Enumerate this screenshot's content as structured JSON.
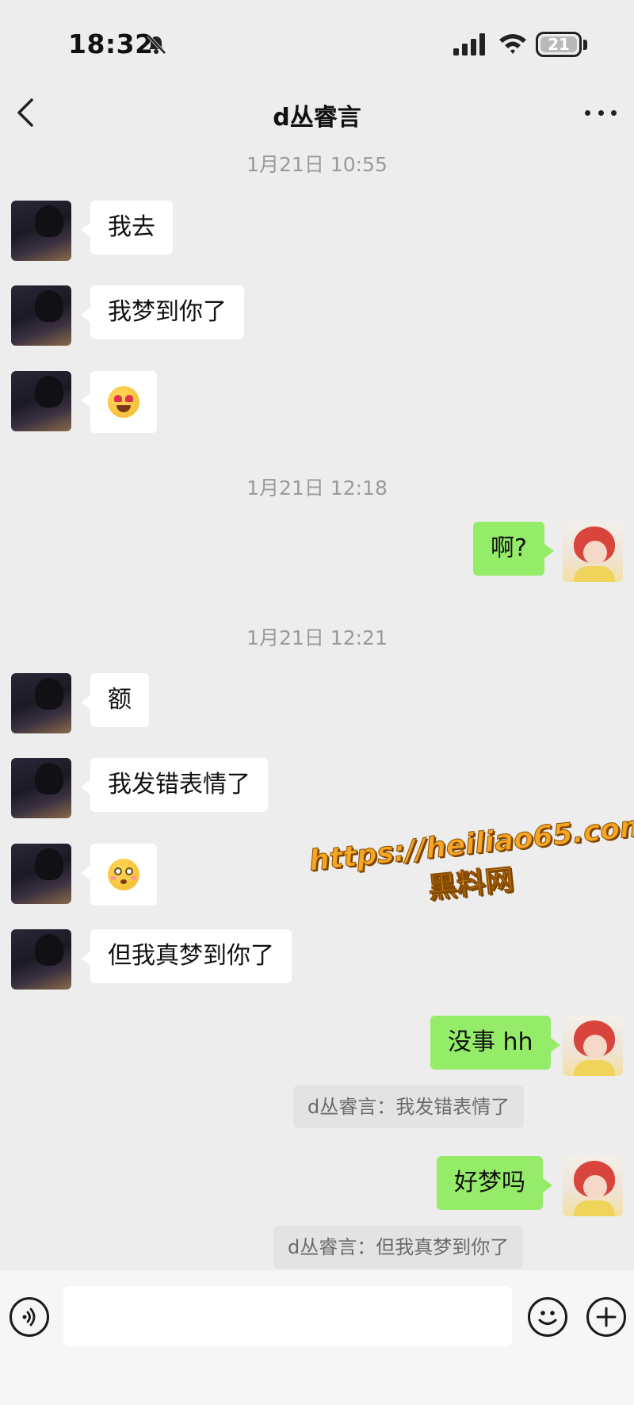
{
  "status_bar": {
    "time": "18:32",
    "battery_level": "21",
    "icons": [
      "bell-muted-icon",
      "signal-icon",
      "wifi-icon",
      "battery-icon"
    ]
  },
  "nav": {
    "title": "d丛睿言",
    "back_icon": "chevron-left-icon",
    "more_icon": "more-dots-icon"
  },
  "timestamps": [
    "1月21日 10:55",
    "1月21日 12:18",
    "1月21日 12:21"
  ],
  "messages": [
    {
      "side": "left",
      "text": "我去"
    },
    {
      "side": "left",
      "text": "我梦到你了"
    },
    {
      "side": "left",
      "emoji": "heart-eyes-emoji-icon"
    },
    {
      "side": "right",
      "text": "啊?"
    },
    {
      "side": "left",
      "text": "额"
    },
    {
      "side": "left",
      "text": "我发错表情了"
    },
    {
      "side": "left",
      "emoji": "flushed-emoji-icon"
    },
    {
      "side": "left",
      "text": "但我真梦到你了"
    },
    {
      "side": "right",
      "text": "没事 hh",
      "quote": "d丛睿言：我发错表情了"
    },
    {
      "side": "right",
      "text": "好梦吗",
      "quote": "d丛睿言：但我真梦到你了"
    }
  ],
  "watermark": {
    "url": "https://heiliao65.com",
    "name": "黑料网"
  },
  "input_bar": {
    "voice_icon": "voice-icon",
    "emoji_icon": "smiley-icon",
    "plus_icon": "plus-icon",
    "placeholder": ""
  },
  "colors": {
    "background": "#ededed",
    "bubble_left": "#ffffff",
    "bubble_right": "#95ec69",
    "timestamp": "#9a9a9a",
    "watermark": "#f5a623"
  }
}
